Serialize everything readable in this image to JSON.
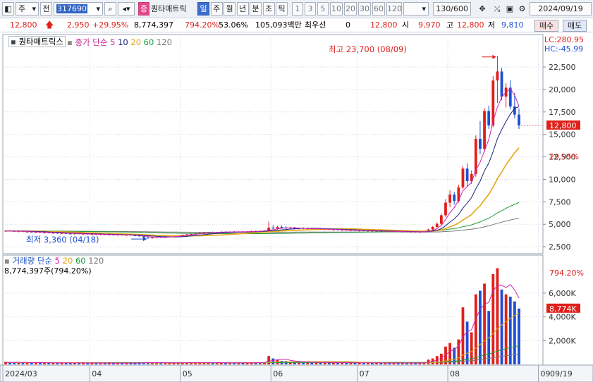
{
  "toolbar": {
    "market": "주",
    "front": "전",
    "code": "317690",
    "badge": "증",
    "name": "퀀타매트릭",
    "periods": [
      "일",
      "주",
      "월",
      "년",
      "분",
      "초",
      "틱"
    ],
    "active_period": "일",
    "intervals": [
      "1",
      "3",
      "5",
      "10",
      "20",
      "30",
      "60",
      "120"
    ],
    "count": "130/600",
    "date": "2024/09/19"
  },
  "quote": {
    "price": "12,800",
    "change": "2,950",
    "change_pct": "+29.95%",
    "volume": "8,774,397",
    "volume_pct": "794.20%",
    "turnover_pct": "53.06%",
    "amount": "105,093백만",
    "priority_label": "최우선",
    "priority_value": "0",
    "bid": "12,800",
    "open_label": "시",
    "open": "9,970",
    "high_label": "고",
    "high": "12,800",
    "low_label": "저",
    "low": "9,810",
    "buy": "매수",
    "sell": "매도"
  },
  "price_panel": {
    "name": "퀀타매트릭스",
    "ma_label": "종가 단순",
    "ma_periods": [
      "5",
      "10",
      "20",
      "60",
      "120"
    ],
    "lc": "LC:280.95",
    "hc": "HC:-45.99",
    "high_note": "최고 23,700 (08/09)",
    "low_note": "최저 3,360 (04/18)",
    "last_price": "12,800",
    "last_pct": "29.95%"
  },
  "volume_panel": {
    "ma_label": "거래량 단순",
    "ma_periods": [
      "5",
      "20",
      "60",
      "120"
    ],
    "total": "8,774,397주(794.20%)",
    "last_label": "8,774K",
    "last_pct": "794.20%"
  },
  "colors": {
    "up": "#e0201b",
    "down": "#1e4fd6",
    "ma5": "#d21fb0",
    "ma10": "#1a237e",
    "ma20": "#e6a511",
    "ma60": "#1f9a3a",
    "ma120": "#777777"
  },
  "chart_data": {
    "type": "candlestick",
    "x_ticks": [
      "2024/03",
      "04",
      "05",
      "06",
      "07",
      "08",
      "09",
      "09/19"
    ],
    "price_ticks": [
      2500,
      5000,
      7500,
      10000,
      12500,
      15000,
      17500,
      20000,
      22500
    ],
    "volume_ticks": [
      "2,000K",
      "4,000K",
      "6,000K"
    ],
    "volume_tick_values": [
      2000,
      4000,
      6000
    ],
    "price_range": [
      1800,
      24700
    ],
    "volume_range": [
      0,
      8900
    ],
    "high": 23700,
    "low": 3360,
    "candles": [
      [
        4200,
        4320,
        4150,
        4280,
        210
      ],
      [
        4280,
        4330,
        4200,
        4240,
        180
      ],
      [
        4240,
        4280,
        4150,
        4190,
        170
      ],
      [
        4190,
        4250,
        4120,
        4220,
        160
      ],
      [
        4220,
        4260,
        4120,
        4150,
        150
      ],
      [
        4150,
        4200,
        4080,
        4170,
        150
      ],
      [
        4170,
        4210,
        4070,
        4100,
        140
      ],
      [
        4100,
        4180,
        4040,
        4140,
        150
      ],
      [
        4140,
        4190,
        4050,
        4080,
        140
      ],
      [
        4080,
        4130,
        3990,
        4090,
        140
      ],
      [
        4090,
        4150,
        4000,
        4030,
        130
      ],
      [
        4030,
        4080,
        3960,
        4050,
        130
      ],
      [
        4050,
        4090,
        3950,
        3990,
        130
      ],
      [
        3990,
        4040,
        3920,
        4010,
        120
      ],
      [
        4010,
        4060,
        3930,
        3960,
        130
      ],
      [
        3960,
        4010,
        3880,
        3940,
        120
      ],
      [
        3940,
        3990,
        3850,
        3980,
        120
      ],
      [
        3980,
        4020,
        3880,
        3900,
        120
      ],
      [
        3900,
        3960,
        3820,
        3940,
        120
      ],
      [
        3940,
        3980,
        3850,
        3870,
        110
      ],
      [
        3870,
        3930,
        3800,
        3900,
        120
      ],
      [
        3900,
        3950,
        3810,
        3840,
        110
      ],
      [
        3840,
        3900,
        3770,
        3880,
        120
      ],
      [
        3880,
        3930,
        3800,
        3830,
        110
      ],
      [
        3830,
        3880,
        3750,
        3860,
        120
      ],
      [
        3860,
        3900,
        3770,
        3800,
        110
      ],
      [
        3800,
        3860,
        3720,
        3840,
        110
      ],
      [
        3840,
        3890,
        3760,
        3780,
        110
      ],
      [
        3780,
        3840,
        3700,
        3820,
        110
      ],
      [
        3820,
        3870,
        3740,
        3760,
        110
      ],
      [
        3760,
        3820,
        3680,
        3740,
        120
      ],
      [
        3740,
        3790,
        3620,
        3660,
        140
      ],
      [
        3660,
        3700,
        3480,
        3520,
        160
      ],
      [
        3520,
        3560,
        3360,
        3440,
        180
      ],
      [
        3440,
        3560,
        3400,
        3520,
        150
      ],
      [
        3520,
        3600,
        3480,
        3560,
        130
      ],
      [
        3560,
        3620,
        3500,
        3540,
        120
      ],
      [
        3540,
        3620,
        3490,
        3600,
        120
      ],
      [
        3600,
        3680,
        3560,
        3650,
        130
      ],
      [
        3650,
        3720,
        3600,
        3690,
        130
      ],
      [
        3690,
        3780,
        3640,
        3760,
        140
      ],
      [
        3760,
        3860,
        3720,
        3830,
        150
      ],
      [
        3830,
        3920,
        3780,
        3880,
        160
      ],
      [
        3880,
        3960,
        3840,
        3920,
        150
      ],
      [
        3920,
        4020,
        3880,
        3990,
        160
      ],
      [
        3990,
        4080,
        3950,
        4040,
        160
      ],
      [
        4040,
        4110,
        3990,
        4080,
        150
      ],
      [
        4080,
        4150,
        4030,
        4120,
        150
      ],
      [
        4120,
        4180,
        4060,
        4100,
        140
      ],
      [
        4100,
        4160,
        4050,
        4140,
        140
      ],
      [
        4140,
        4200,
        4080,
        4160,
        140
      ],
      [
        4160,
        4220,
        4100,
        4130,
        130
      ],
      [
        4130,
        4200,
        4080,
        4180,
        130
      ],
      [
        4180,
        4240,
        4120,
        4150,
        130
      ],
      [
        4150,
        4210,
        4090,
        4190,
        140
      ],
      [
        4190,
        4250,
        4130,
        4160,
        130
      ],
      [
        4160,
        4220,
        4100,
        4200,
        130
      ],
      [
        4200,
        4300,
        4150,
        4240,
        160
      ],
      [
        4240,
        4320,
        4180,
        4210,
        160
      ],
      [
        4210,
        4290,
        4160,
        4260,
        150
      ],
      [
        4260,
        4350,
        4200,
        4300,
        170
      ],
      [
        4300,
        5300,
        4260,
        4620,
        700
      ],
      [
        4620,
        4900,
        4450,
        4520,
        500
      ],
      [
        4520,
        4820,
        4400,
        4700,
        400
      ],
      [
        4700,
        4850,
        4550,
        4600,
        300
      ],
      [
        4600,
        4780,
        4500,
        4560,
        280
      ],
      [
        4560,
        4700,
        4450,
        4620,
        240
      ],
      [
        4620,
        4720,
        4480,
        4500,
        220
      ],
      [
        4500,
        4640,
        4400,
        4580,
        200
      ],
      [
        4580,
        4660,
        4450,
        4480,
        190
      ],
      [
        4480,
        4600,
        4400,
        4540,
        180
      ],
      [
        4540,
        4620,
        4420,
        4450,
        170
      ],
      [
        4450,
        4560,
        4360,
        4500,
        160
      ],
      [
        4500,
        4580,
        4380,
        4420,
        160
      ],
      [
        4420,
        4520,
        4320,
        4460,
        150
      ],
      [
        4460,
        4540,
        4340,
        4380,
        150
      ],
      [
        4380,
        4480,
        4300,
        4420,
        140
      ],
      [
        4420,
        4500,
        4320,
        4350,
        140
      ],
      [
        4350,
        4450,
        4270,
        4390,
        140
      ],
      [
        4390,
        4460,
        4280,
        4310,
        130
      ],
      [
        4310,
        4400,
        4230,
        4350,
        130
      ],
      [
        4350,
        4420,
        4250,
        4280,
        130
      ],
      [
        4280,
        4360,
        4200,
        4320,
        130
      ],
      [
        4320,
        4390,
        4220,
        4250,
        130
      ],
      [
        4250,
        4330,
        4170,
        4290,
        120
      ],
      [
        4290,
        4360,
        4190,
        4220,
        120
      ],
      [
        4220,
        4300,
        4140,
        4260,
        120
      ],
      [
        4260,
        4320,
        4160,
        4190,
        120
      ],
      [
        4190,
        4270,
        4110,
        4230,
        120
      ],
      [
        4230,
        4300,
        4130,
        4170,
        120
      ],
      [
        4170,
        4250,
        4090,
        4210,
        120
      ],
      [
        4210,
        4280,
        4120,
        4150,
        120
      ],
      [
        4150,
        4230,
        4070,
        4190,
        120
      ],
      [
        4190,
        4260,
        4100,
        4130,
        120
      ],
      [
        4130,
        4210,
        4050,
        4170,
        120
      ],
      [
        4170,
        4240,
        4080,
        4110,
        120
      ],
      [
        4110,
        4190,
        4030,
        4150,
        120
      ],
      [
        4150,
        4230,
        4060,
        4200,
        130
      ],
      [
        4200,
        4500,
        4150,
        4420,
        400
      ],
      [
        4420,
        4800,
        4350,
        4700,
        500
      ],
      [
        4700,
        5200,
        4600,
        5050,
        700
      ],
      [
        5050,
        6200,
        4950,
        6000,
        900
      ],
      [
        6000,
        7800,
        5800,
        7400,
        1500
      ],
      [
        7400,
        8800,
        6900,
        8300,
        1800
      ],
      [
        8300,
        8600,
        7200,
        7600,
        1400
      ],
      [
        7600,
        9400,
        7400,
        9100,
        2100
      ],
      [
        9100,
        11500,
        8900,
        11200,
        4800
      ],
      [
        11200,
        11800,
        9200,
        9800,
        3600
      ],
      [
        9800,
        11000,
        9500,
        10600,
        2700
      ],
      [
        10600,
        14900,
        10300,
        14500,
        5900
      ],
      [
        14500,
        16500,
        12800,
        13400,
        6200
      ],
      [
        13400,
        17900,
        13000,
        17600,
        6800
      ],
      [
        17600,
        18200,
        15600,
        16000,
        4500
      ],
      [
        16000,
        21500,
        15800,
        21000,
        7600
      ],
      [
        21000,
        23700,
        18500,
        22000,
        8100
      ],
      [
        22000,
        22400,
        18800,
        19200,
        6300
      ],
      [
        19200,
        20700,
        18000,
        20200,
        5900
      ],
      [
        20200,
        21000,
        17800,
        18100,
        5700
      ],
      [
        18100,
        19600,
        16800,
        17200,
        5300
      ],
      [
        17200,
        17900,
        15600,
        16000,
        4700
      ]
    ]
  }
}
